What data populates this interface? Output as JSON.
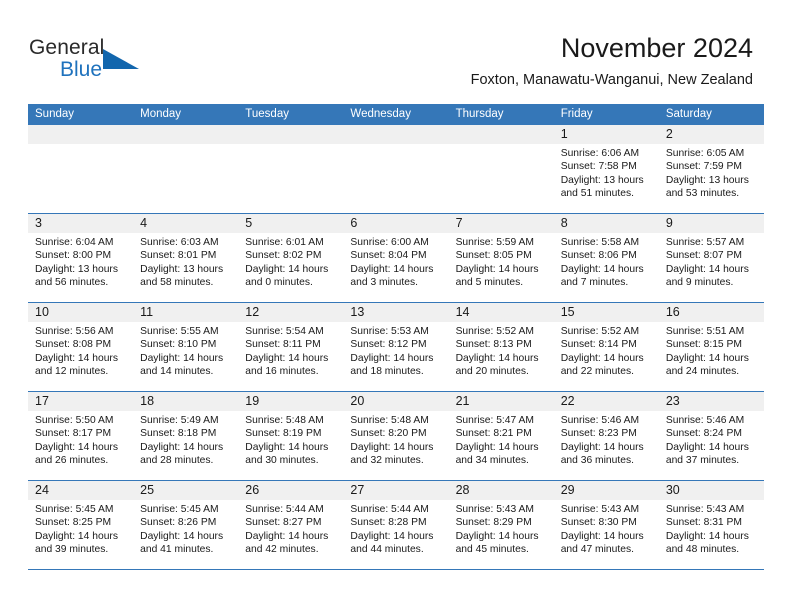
{
  "brand": {
    "name_top": "General",
    "name_bottom": "Blue",
    "accent_color": "#1266ad",
    "text_color": "#2a2a2a"
  },
  "header": {
    "title": "November 2024",
    "subtitle": "Foxton, Manawatu-Wanganui, New Zealand"
  },
  "calendar": {
    "header_bg": "#3577b8",
    "daynum_band_bg": "#f0f0f0",
    "weekdays": [
      "Sunday",
      "Monday",
      "Tuesday",
      "Wednesday",
      "Thursday",
      "Friday",
      "Saturday"
    ],
    "weeks": [
      [
        {
          "day": "",
          "lines": []
        },
        {
          "day": "",
          "lines": []
        },
        {
          "day": "",
          "lines": []
        },
        {
          "day": "",
          "lines": []
        },
        {
          "day": "",
          "lines": []
        },
        {
          "day": "1",
          "lines": [
            "Sunrise: 6:06 AM",
            "Sunset: 7:58 PM",
            "Daylight: 13 hours",
            "and 51 minutes."
          ]
        },
        {
          "day": "2",
          "lines": [
            "Sunrise: 6:05 AM",
            "Sunset: 7:59 PM",
            "Daylight: 13 hours",
            "and 53 minutes."
          ]
        }
      ],
      [
        {
          "day": "3",
          "lines": [
            "Sunrise: 6:04 AM",
            "Sunset: 8:00 PM",
            "Daylight: 13 hours",
            "and 56 minutes."
          ]
        },
        {
          "day": "4",
          "lines": [
            "Sunrise: 6:03 AM",
            "Sunset: 8:01 PM",
            "Daylight: 13 hours",
            "and 58 minutes."
          ]
        },
        {
          "day": "5",
          "lines": [
            "Sunrise: 6:01 AM",
            "Sunset: 8:02 PM",
            "Daylight: 14 hours",
            "and 0 minutes."
          ]
        },
        {
          "day": "6",
          "lines": [
            "Sunrise: 6:00 AM",
            "Sunset: 8:04 PM",
            "Daylight: 14 hours",
            "and 3 minutes."
          ]
        },
        {
          "day": "7",
          "lines": [
            "Sunrise: 5:59 AM",
            "Sunset: 8:05 PM",
            "Daylight: 14 hours",
            "and 5 minutes."
          ]
        },
        {
          "day": "8",
          "lines": [
            "Sunrise: 5:58 AM",
            "Sunset: 8:06 PM",
            "Daylight: 14 hours",
            "and 7 minutes."
          ]
        },
        {
          "day": "9",
          "lines": [
            "Sunrise: 5:57 AM",
            "Sunset: 8:07 PM",
            "Daylight: 14 hours",
            "and 9 minutes."
          ]
        }
      ],
      [
        {
          "day": "10",
          "lines": [
            "Sunrise: 5:56 AM",
            "Sunset: 8:08 PM",
            "Daylight: 14 hours",
            "and 12 minutes."
          ]
        },
        {
          "day": "11",
          "lines": [
            "Sunrise: 5:55 AM",
            "Sunset: 8:10 PM",
            "Daylight: 14 hours",
            "and 14 minutes."
          ]
        },
        {
          "day": "12",
          "lines": [
            "Sunrise: 5:54 AM",
            "Sunset: 8:11 PM",
            "Daylight: 14 hours",
            "and 16 minutes."
          ]
        },
        {
          "day": "13",
          "lines": [
            "Sunrise: 5:53 AM",
            "Sunset: 8:12 PM",
            "Daylight: 14 hours",
            "and 18 minutes."
          ]
        },
        {
          "day": "14",
          "lines": [
            "Sunrise: 5:52 AM",
            "Sunset: 8:13 PM",
            "Daylight: 14 hours",
            "and 20 minutes."
          ]
        },
        {
          "day": "15",
          "lines": [
            "Sunrise: 5:52 AM",
            "Sunset: 8:14 PM",
            "Daylight: 14 hours",
            "and 22 minutes."
          ]
        },
        {
          "day": "16",
          "lines": [
            "Sunrise: 5:51 AM",
            "Sunset: 8:15 PM",
            "Daylight: 14 hours",
            "and 24 minutes."
          ]
        }
      ],
      [
        {
          "day": "17",
          "lines": [
            "Sunrise: 5:50 AM",
            "Sunset: 8:17 PM",
            "Daylight: 14 hours",
            "and 26 minutes."
          ]
        },
        {
          "day": "18",
          "lines": [
            "Sunrise: 5:49 AM",
            "Sunset: 8:18 PM",
            "Daylight: 14 hours",
            "and 28 minutes."
          ]
        },
        {
          "day": "19",
          "lines": [
            "Sunrise: 5:48 AM",
            "Sunset: 8:19 PM",
            "Daylight: 14 hours",
            "and 30 minutes."
          ]
        },
        {
          "day": "20",
          "lines": [
            "Sunrise: 5:48 AM",
            "Sunset: 8:20 PM",
            "Daylight: 14 hours",
            "and 32 minutes."
          ]
        },
        {
          "day": "21",
          "lines": [
            "Sunrise: 5:47 AM",
            "Sunset: 8:21 PM",
            "Daylight: 14 hours",
            "and 34 minutes."
          ]
        },
        {
          "day": "22",
          "lines": [
            "Sunrise: 5:46 AM",
            "Sunset: 8:23 PM",
            "Daylight: 14 hours",
            "and 36 minutes."
          ]
        },
        {
          "day": "23",
          "lines": [
            "Sunrise: 5:46 AM",
            "Sunset: 8:24 PM",
            "Daylight: 14 hours",
            "and 37 minutes."
          ]
        }
      ],
      [
        {
          "day": "24",
          "lines": [
            "Sunrise: 5:45 AM",
            "Sunset: 8:25 PM",
            "Daylight: 14 hours",
            "and 39 minutes."
          ]
        },
        {
          "day": "25",
          "lines": [
            "Sunrise: 5:45 AM",
            "Sunset: 8:26 PM",
            "Daylight: 14 hours",
            "and 41 minutes."
          ]
        },
        {
          "day": "26",
          "lines": [
            "Sunrise: 5:44 AM",
            "Sunset: 8:27 PM",
            "Daylight: 14 hours",
            "and 42 minutes."
          ]
        },
        {
          "day": "27",
          "lines": [
            "Sunrise: 5:44 AM",
            "Sunset: 8:28 PM",
            "Daylight: 14 hours",
            "and 44 minutes."
          ]
        },
        {
          "day": "28",
          "lines": [
            "Sunrise: 5:43 AM",
            "Sunset: 8:29 PM",
            "Daylight: 14 hours",
            "and 45 minutes."
          ]
        },
        {
          "day": "29",
          "lines": [
            "Sunrise: 5:43 AM",
            "Sunset: 8:30 PM",
            "Daylight: 14 hours",
            "and 47 minutes."
          ]
        },
        {
          "day": "30",
          "lines": [
            "Sunrise: 5:43 AM",
            "Sunset: 8:31 PM",
            "Daylight: 14 hours",
            "and 48 minutes."
          ]
        }
      ]
    ]
  }
}
